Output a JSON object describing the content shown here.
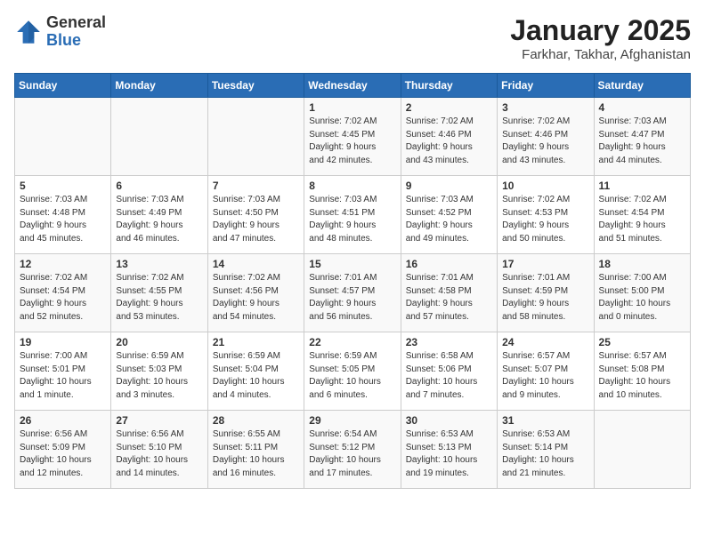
{
  "header": {
    "logo_general": "General",
    "logo_blue": "Blue",
    "month": "January 2025",
    "location": "Farkhar, Takhar, Afghanistan"
  },
  "days_of_week": [
    "Sunday",
    "Monday",
    "Tuesday",
    "Wednesday",
    "Thursday",
    "Friday",
    "Saturday"
  ],
  "weeks": [
    [
      {
        "day": "",
        "info": ""
      },
      {
        "day": "",
        "info": ""
      },
      {
        "day": "",
        "info": ""
      },
      {
        "day": "1",
        "info": "Sunrise: 7:02 AM\nSunset: 4:45 PM\nDaylight: 9 hours\nand 42 minutes."
      },
      {
        "day": "2",
        "info": "Sunrise: 7:02 AM\nSunset: 4:46 PM\nDaylight: 9 hours\nand 43 minutes."
      },
      {
        "day": "3",
        "info": "Sunrise: 7:02 AM\nSunset: 4:46 PM\nDaylight: 9 hours\nand 43 minutes."
      },
      {
        "day": "4",
        "info": "Sunrise: 7:03 AM\nSunset: 4:47 PM\nDaylight: 9 hours\nand 44 minutes."
      }
    ],
    [
      {
        "day": "5",
        "info": "Sunrise: 7:03 AM\nSunset: 4:48 PM\nDaylight: 9 hours\nand 45 minutes."
      },
      {
        "day": "6",
        "info": "Sunrise: 7:03 AM\nSunset: 4:49 PM\nDaylight: 9 hours\nand 46 minutes."
      },
      {
        "day": "7",
        "info": "Sunrise: 7:03 AM\nSunset: 4:50 PM\nDaylight: 9 hours\nand 47 minutes."
      },
      {
        "day": "8",
        "info": "Sunrise: 7:03 AM\nSunset: 4:51 PM\nDaylight: 9 hours\nand 48 minutes."
      },
      {
        "day": "9",
        "info": "Sunrise: 7:03 AM\nSunset: 4:52 PM\nDaylight: 9 hours\nand 49 minutes."
      },
      {
        "day": "10",
        "info": "Sunrise: 7:02 AM\nSunset: 4:53 PM\nDaylight: 9 hours\nand 50 minutes."
      },
      {
        "day": "11",
        "info": "Sunrise: 7:02 AM\nSunset: 4:54 PM\nDaylight: 9 hours\nand 51 minutes."
      }
    ],
    [
      {
        "day": "12",
        "info": "Sunrise: 7:02 AM\nSunset: 4:54 PM\nDaylight: 9 hours\nand 52 minutes."
      },
      {
        "day": "13",
        "info": "Sunrise: 7:02 AM\nSunset: 4:55 PM\nDaylight: 9 hours\nand 53 minutes."
      },
      {
        "day": "14",
        "info": "Sunrise: 7:02 AM\nSunset: 4:56 PM\nDaylight: 9 hours\nand 54 minutes."
      },
      {
        "day": "15",
        "info": "Sunrise: 7:01 AM\nSunset: 4:57 PM\nDaylight: 9 hours\nand 56 minutes."
      },
      {
        "day": "16",
        "info": "Sunrise: 7:01 AM\nSunset: 4:58 PM\nDaylight: 9 hours\nand 57 minutes."
      },
      {
        "day": "17",
        "info": "Sunrise: 7:01 AM\nSunset: 4:59 PM\nDaylight: 9 hours\nand 58 minutes."
      },
      {
        "day": "18",
        "info": "Sunrise: 7:00 AM\nSunset: 5:00 PM\nDaylight: 10 hours\nand 0 minutes."
      }
    ],
    [
      {
        "day": "19",
        "info": "Sunrise: 7:00 AM\nSunset: 5:01 PM\nDaylight: 10 hours\nand 1 minute."
      },
      {
        "day": "20",
        "info": "Sunrise: 6:59 AM\nSunset: 5:03 PM\nDaylight: 10 hours\nand 3 minutes."
      },
      {
        "day": "21",
        "info": "Sunrise: 6:59 AM\nSunset: 5:04 PM\nDaylight: 10 hours\nand 4 minutes."
      },
      {
        "day": "22",
        "info": "Sunrise: 6:59 AM\nSunset: 5:05 PM\nDaylight: 10 hours\nand 6 minutes."
      },
      {
        "day": "23",
        "info": "Sunrise: 6:58 AM\nSunset: 5:06 PM\nDaylight: 10 hours\nand 7 minutes."
      },
      {
        "day": "24",
        "info": "Sunrise: 6:57 AM\nSunset: 5:07 PM\nDaylight: 10 hours\nand 9 minutes."
      },
      {
        "day": "25",
        "info": "Sunrise: 6:57 AM\nSunset: 5:08 PM\nDaylight: 10 hours\nand 10 minutes."
      }
    ],
    [
      {
        "day": "26",
        "info": "Sunrise: 6:56 AM\nSunset: 5:09 PM\nDaylight: 10 hours\nand 12 minutes."
      },
      {
        "day": "27",
        "info": "Sunrise: 6:56 AM\nSunset: 5:10 PM\nDaylight: 10 hours\nand 14 minutes."
      },
      {
        "day": "28",
        "info": "Sunrise: 6:55 AM\nSunset: 5:11 PM\nDaylight: 10 hours\nand 16 minutes."
      },
      {
        "day": "29",
        "info": "Sunrise: 6:54 AM\nSunset: 5:12 PM\nDaylight: 10 hours\nand 17 minutes."
      },
      {
        "day": "30",
        "info": "Sunrise: 6:53 AM\nSunset: 5:13 PM\nDaylight: 10 hours\nand 19 minutes."
      },
      {
        "day": "31",
        "info": "Sunrise: 6:53 AM\nSunset: 5:14 PM\nDaylight: 10 hours\nand 21 minutes."
      },
      {
        "day": "",
        "info": ""
      }
    ]
  ]
}
